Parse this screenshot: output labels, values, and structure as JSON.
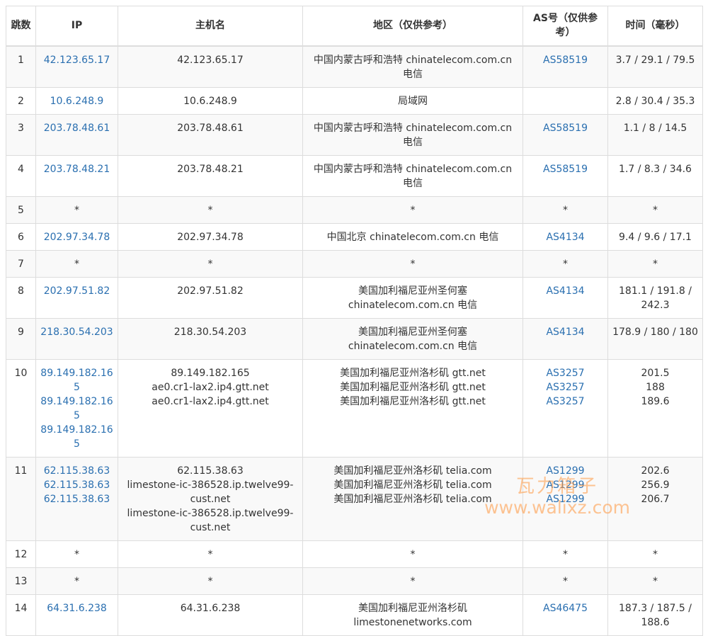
{
  "headers": {
    "hop": "跳数",
    "ip": "IP",
    "host": "主机名",
    "region": "地区（仅供参考）",
    "as": "AS号（仅供参考）",
    "time": "时间（毫秒）"
  },
  "rows": [
    {
      "hop": "1",
      "ip": [
        "42.123.65.17"
      ],
      "host": [
        "42.123.65.17"
      ],
      "region": [
        "中国内蒙古呼和浩特 chinatelecom.com.cn 电信"
      ],
      "as": [
        "AS58519"
      ],
      "time": [
        "3.7 / 29.1 / 79.5"
      ]
    },
    {
      "hop": "2",
      "ip": [
        "10.6.248.9"
      ],
      "host": [
        "10.6.248.9"
      ],
      "region": [
        "局域网"
      ],
      "as": [],
      "time": [
        "2.8 / 30.4 / 35.3"
      ]
    },
    {
      "hop": "3",
      "ip": [
        "203.78.48.61"
      ],
      "host": [
        "203.78.48.61"
      ],
      "region": [
        "中国内蒙古呼和浩特 chinatelecom.com.cn 电信"
      ],
      "as": [
        "AS58519"
      ],
      "time": [
        "1.1 / 8 / 14.5"
      ]
    },
    {
      "hop": "4",
      "ip": [
        "203.78.48.21"
      ],
      "host": [
        "203.78.48.21"
      ],
      "region": [
        "中国内蒙古呼和浩特 chinatelecom.com.cn 电信"
      ],
      "as": [
        "AS58519"
      ],
      "time": [
        "1.7 / 8.3 / 34.6"
      ]
    },
    {
      "hop": "5",
      "ip": [
        "*"
      ],
      "host": [
        "*"
      ],
      "region": [
        "*"
      ],
      "as": [
        "*"
      ],
      "time": [
        "*"
      ],
      "plain_ip": true
    },
    {
      "hop": "6",
      "ip": [
        "202.97.34.78"
      ],
      "host": [
        "202.97.34.78"
      ],
      "region": [
        "中国北京 chinatelecom.com.cn 电信"
      ],
      "as": [
        "AS4134"
      ],
      "time": [
        "9.4 / 9.6 / 17.1"
      ]
    },
    {
      "hop": "7",
      "ip": [
        "*"
      ],
      "host": [
        "*"
      ],
      "region": [
        "*"
      ],
      "as": [
        "*"
      ],
      "time": [
        "*"
      ],
      "plain_ip": true
    },
    {
      "hop": "8",
      "ip": [
        "202.97.51.82"
      ],
      "host": [
        "202.97.51.82"
      ],
      "region": [
        "美国加利福尼亚州圣何塞 chinatelecom.com.cn 电信"
      ],
      "as": [
        "AS4134"
      ],
      "time": [
        "181.1 / 191.8 / 242.3"
      ]
    },
    {
      "hop": "9",
      "ip": [
        "218.30.54.203"
      ],
      "host": [
        "218.30.54.203"
      ],
      "region": [
        "美国加利福尼亚州圣何塞 chinatelecom.com.cn 电信"
      ],
      "as": [
        "AS4134"
      ],
      "time": [
        "178.9 / 180 / 180"
      ]
    },
    {
      "hop": "10",
      "ip": [
        "89.149.182.165",
        "89.149.182.165",
        "89.149.182.165"
      ],
      "host": [
        "89.149.182.165",
        "ae0.cr1-lax2.ip4.gtt.net",
        "ae0.cr1-lax2.ip4.gtt.net"
      ],
      "region": [
        "美国加利福尼亚州洛杉矶 gtt.net",
        "美国加利福尼亚州洛杉矶 gtt.net",
        "美国加利福尼亚州洛杉矶 gtt.net"
      ],
      "as": [
        "AS3257",
        "AS3257",
        "AS3257"
      ],
      "time": [
        "201.5",
        "188",
        "189.6"
      ]
    },
    {
      "hop": "11",
      "ip": [
        "62.115.38.63",
        "62.115.38.63",
        "62.115.38.63"
      ],
      "host": [
        "62.115.38.63",
        "limestone-ic-386528.ip.twelve99-cust.net",
        "limestone-ic-386528.ip.twelve99-cust.net"
      ],
      "region": [
        "美国加利福尼亚州洛杉矶 telia.com",
        "美国加利福尼亚州洛杉矶 telia.com",
        "美国加利福尼亚州洛杉矶 telia.com"
      ],
      "as": [
        "AS1299",
        "AS1299",
        "AS1299"
      ],
      "time": [
        "202.6",
        "256.9",
        "206.7"
      ]
    },
    {
      "hop": "12",
      "ip": [
        "*"
      ],
      "host": [
        "*"
      ],
      "region": [
        "*"
      ],
      "as": [
        "*"
      ],
      "time": [
        "*"
      ],
      "plain_ip": true
    },
    {
      "hop": "13",
      "ip": [
        "*"
      ],
      "host": [
        "*"
      ],
      "region": [
        "*"
      ],
      "as": [
        "*"
      ],
      "time": [
        "*"
      ],
      "plain_ip": true
    },
    {
      "hop": "14",
      "ip": [
        "64.31.6.238"
      ],
      "host": [
        "64.31.6.238"
      ],
      "region": [
        "美国加利福尼亚州洛杉矶 limestonenetworks.com"
      ],
      "as": [
        "AS46475"
      ],
      "time": [
        "187.3 / 187.5 / 188.6"
      ]
    }
  ],
  "watermark": {
    "cn": "瓦力箱子",
    "en": "www.walixz.com"
  },
  "colors": {
    "link": "#2a6fb0",
    "border": "#dddddd",
    "stripe": "#f9f9f9",
    "watermark": "#ff963c"
  }
}
